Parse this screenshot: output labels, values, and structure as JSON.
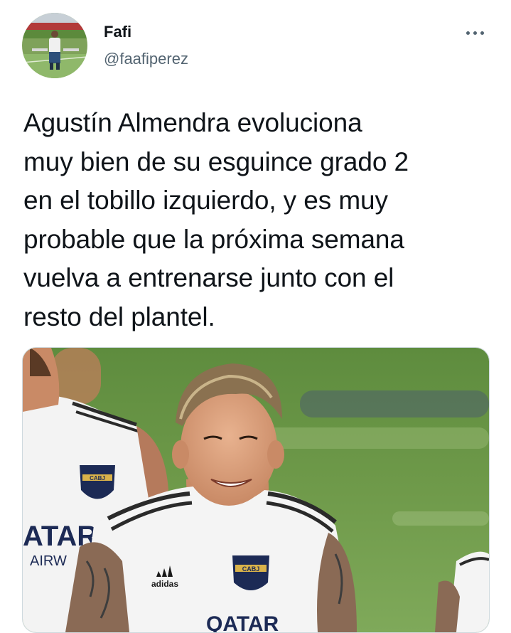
{
  "author": {
    "display_name": "Fafi",
    "handle": "@faafiperez",
    "avatar_icon": "avatar-photo"
  },
  "menu": {
    "more_icon": "more-horizontal-icon"
  },
  "tweet": {
    "text_lines": [
      "Agustín Almendra evoluciona",
      "muy bien de su esguince grado 2",
      "en el tobillo izquierdo, y es muy",
      "probable que la próxima semana",
      "vuelva a entrenarse junto con el",
      "resto del plantel."
    ]
  },
  "media": {
    "photo": {
      "jersey_crest": "CABJ",
      "jersey_brand": "adidas",
      "jersey_sponsor_left": "ATAR",
      "jersey_sponsor_left_sub": "AIRW",
      "jersey_sponsor_center": "QATAR"
    }
  },
  "colors": {
    "text_primary": "#0f1419",
    "text_secondary": "#536471",
    "border": "#cfd9de",
    "pitch_green": "#6f9a4a",
    "crest_gold": "#d9b24a",
    "crest_navy": "#1c2a55"
  }
}
